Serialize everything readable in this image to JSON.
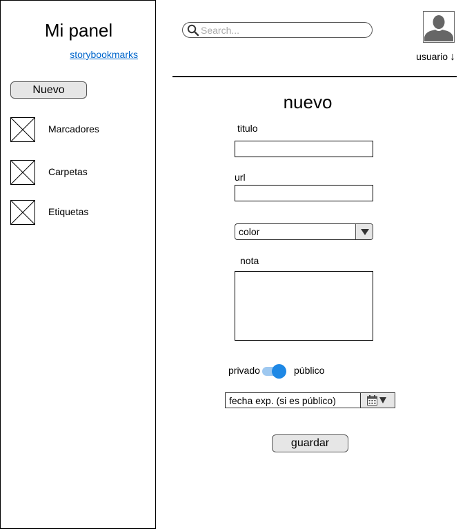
{
  "sidebar": {
    "title": "Mi panel",
    "link": "storybookmarks",
    "new_button": "Nuevo",
    "items": [
      {
        "label": "Marcadores"
      },
      {
        "label": "Carpetas"
      },
      {
        "label": "Etiquetas"
      }
    ]
  },
  "header": {
    "search_placeholder": "Search...",
    "search_icon": "search-icon",
    "avatar_icon": "user-avatar-icon",
    "user_label": "usuario",
    "user_arrow": "↓"
  },
  "form": {
    "title": "nuevo",
    "title_label": "titulo",
    "url_label": "url",
    "color_select": "color",
    "note_label": "nota",
    "private_label": "privado",
    "public_label": "público",
    "toggle_on": true,
    "date_placeholder": "fecha exp. (si es público)",
    "save_button": "guardar"
  },
  "colors": {
    "link": "#0066cc",
    "toggle_knob": "#1e88e5",
    "toggle_track": "#9ec8f0",
    "button_bg": "#e6e6e6",
    "avatar": "#666666"
  }
}
